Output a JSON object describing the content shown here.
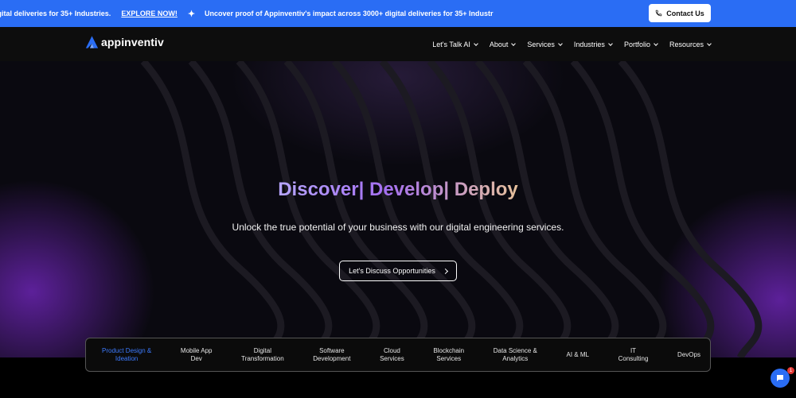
{
  "announcement": {
    "text_1": "igital deliveries for 35+ Industries.",
    "link": "EXPLORE NOW!",
    "separator_icon": "sparkle-icon",
    "text_2": "Uncover proof of Appinventiv's impact across 3000+ digital deliveries for 35+ Industr",
    "contact_label": "Contact Us",
    "contact_icon": "phone-icon"
  },
  "nav": {
    "logo": "appinventiv",
    "items": [
      {
        "label": "Let's Talk AI"
      },
      {
        "label": "About"
      },
      {
        "label": "Services"
      },
      {
        "label": "Industries"
      },
      {
        "label": "Portfolio"
      },
      {
        "label": "Resources"
      }
    ]
  },
  "hero": {
    "title": "Discover| Develop| Deploy",
    "subtitle": "Unlock the true potential of your business with our digital engineering services.",
    "cta_label": "Let's Discuss Opportunities"
  },
  "tabs": [
    {
      "label": "Product Design &\nIdeation",
      "active": true
    },
    {
      "label": "Mobile App\nDev",
      "active": false
    },
    {
      "label": "Digital\nTransformation",
      "active": false
    },
    {
      "label": "Software\nDevelopment",
      "active": false
    },
    {
      "label": "Cloud\nServices",
      "active": false
    },
    {
      "label": "Blockchain\nServices",
      "active": false
    },
    {
      "label": "Data Science &\nAnalytics",
      "active": false
    },
    {
      "label": "AI & ML",
      "active": false
    },
    {
      "label": "IT\nConsulting",
      "active": false
    },
    {
      "label": "DevOps",
      "active": false
    }
  ],
  "chat": {
    "icon": "chat-icon",
    "badge": "1"
  },
  "colors": {
    "accent": "#2a6df4",
    "active_tab": "#3d7bff"
  }
}
